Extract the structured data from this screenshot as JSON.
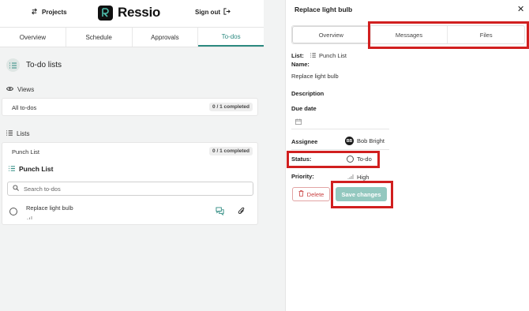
{
  "header": {
    "projects_label": "Projects",
    "brand": "Ressio",
    "signout_label": "Sign out"
  },
  "tabs": [
    {
      "label": "Overview"
    },
    {
      "label": "Schedule"
    },
    {
      "label": "Approvals"
    },
    {
      "label": "To-dos",
      "active": true
    }
  ],
  "page": {
    "title": "To-do lists",
    "views_label": "Views",
    "all_todos_label": "All to-dos",
    "all_todos_badge": "0 / 1 completed",
    "lists_label": "Lists",
    "punch_list_label": "Punch List",
    "punch_list_badge": "0 / 1 completed",
    "punch_list_title": "Punch List",
    "search_placeholder": "Search to-dos",
    "todo_item_label": "Replace light bulb"
  },
  "panel": {
    "title": "Replace light bulb",
    "segments": [
      "Overview",
      "Messages",
      "Files"
    ],
    "list_label": "List:",
    "list_value": "Punch List",
    "name_label": "Name:",
    "name_value": "Replace light bulb",
    "description_label": "Description",
    "due_date_label": "Due date",
    "assignee_label": "Assignee",
    "assignee_initials": "BB",
    "assignee_name": "Bob Bright",
    "status_label": "Status:",
    "status_value": "To-do",
    "priority_label": "Priority:",
    "priority_value": "High",
    "delete_label": "Delete",
    "save_label": "Save changes"
  },
  "colors": {
    "accent": "#2c8a80",
    "save_bg": "#93c8bf",
    "delete": "#c94141",
    "highlight": "#d11f1f"
  }
}
